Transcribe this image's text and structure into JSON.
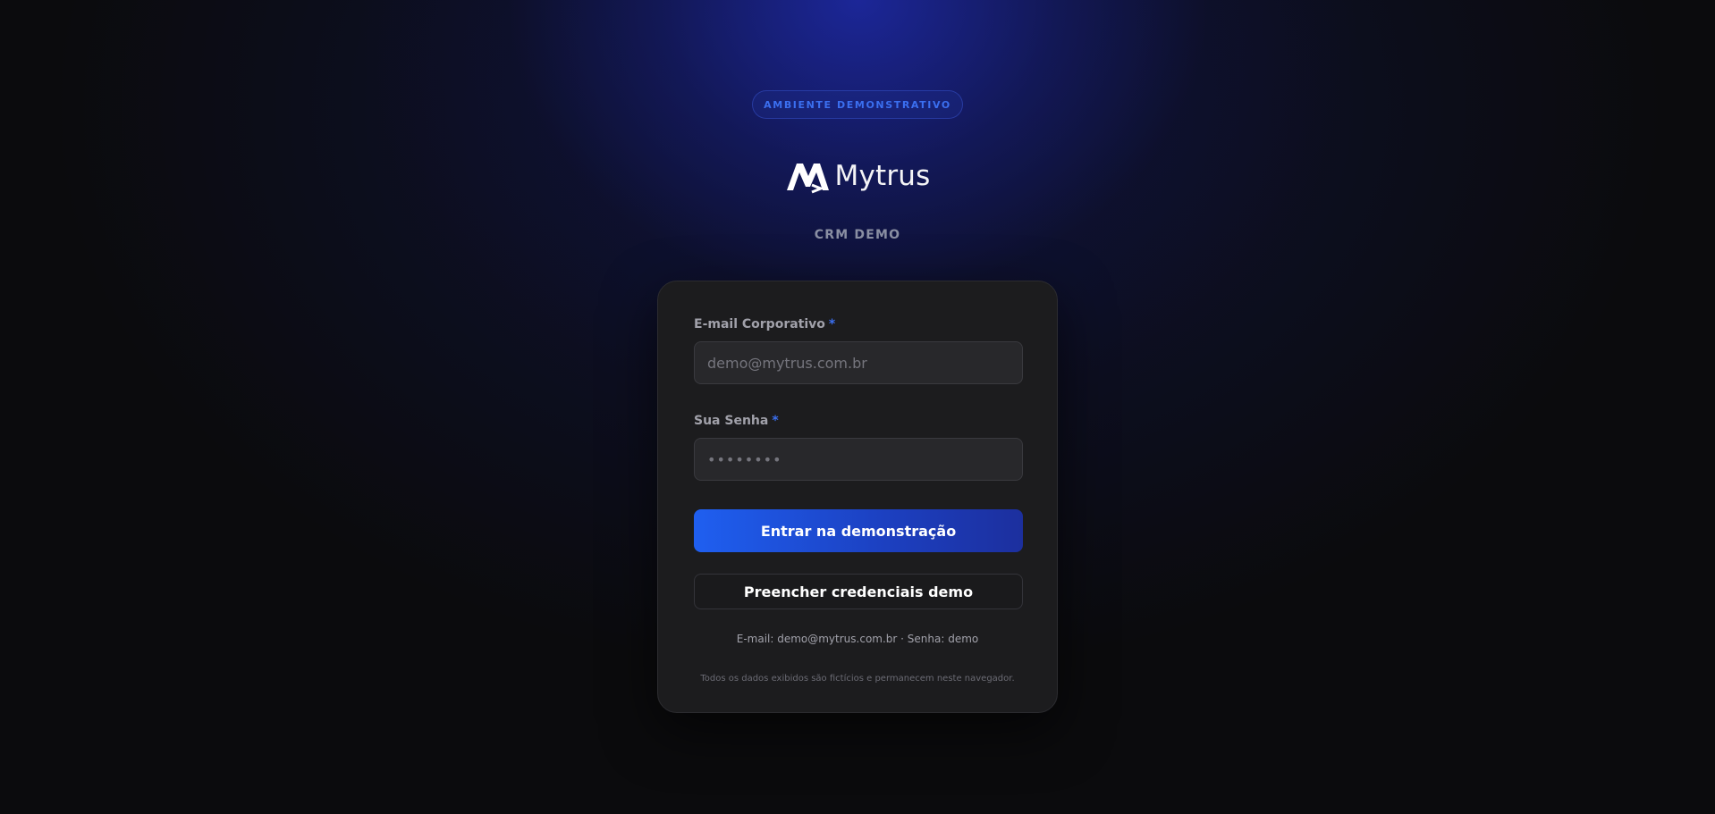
{
  "badge": "AMBIENTE DEMONSTRATIVO",
  "brand": {
    "name": "Mytrus",
    "logo_icon": "mytrus-logo-icon",
    "subtitle": "CRM DEMO"
  },
  "form": {
    "email": {
      "label": "E-mail Corporativo",
      "required_mark": "*",
      "placeholder": "demo@mytrus.com.br",
      "value": ""
    },
    "password": {
      "label": "Sua Senha",
      "required_mark": "*",
      "placeholder": "••••••••",
      "value": ""
    },
    "submit_label": "Entrar na demonstração",
    "fill_label": "Preencher credenciais demo",
    "hint": "E-mail: demo@mytrus.com.br · Senha: demo",
    "disclaimer": "Todos os dados exibidos são fictícios e permanecem neste navegador."
  },
  "colors": {
    "accent": "#1f5ff0",
    "badge_text": "#3b6ff0",
    "card_bg": "#1c1c1e",
    "page_bg": "#0b0b0d",
    "glow": "#1e2aaa"
  }
}
